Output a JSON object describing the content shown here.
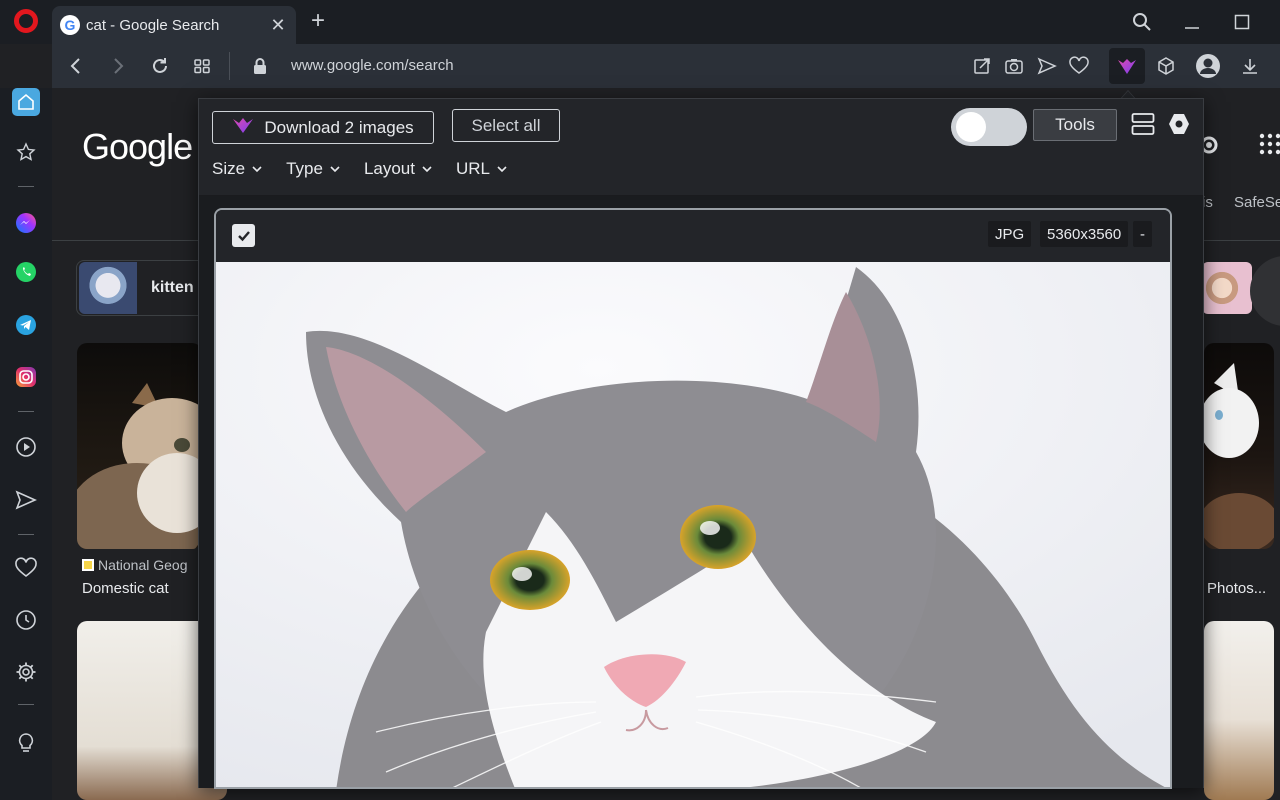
{
  "browser": {
    "tab": {
      "title": "cat - Google Search",
      "favicon": "G",
      "close_glyph": "✕"
    },
    "new_tab_glyph": "+",
    "url": "www.google.com/search"
  },
  "google": {
    "logo": "Google",
    "chip_label": "kitten",
    "results": [
      {
        "source": "National Geog",
        "caption": "Domestic cat"
      }
    ],
    "right_caption": "Photos...",
    "header_partial": {
      "as": "is",
      "safe": "SafeSe"
    }
  },
  "popup": {
    "download_label": "Download 2 images",
    "select_all_label": "Select all",
    "tools_label": "Tools",
    "toggle_on": false,
    "filters": [
      "Size",
      "Type",
      "Layout",
      "URL"
    ],
    "image": {
      "checked": true,
      "format": "JPG",
      "dimensions": "5360x3560",
      "extra": "-"
    }
  },
  "colors": {
    "opera_red": "#e3171e",
    "heart_gradient_start": "#c13ae0",
    "heart_gradient_end": "#7a3ef0",
    "cat_eye": "#d8a32a"
  },
  "icons": {
    "sidebar": [
      "home-icon",
      "star-icon",
      "messenger-icon",
      "whatsapp-icon",
      "telegram-icon",
      "instagram-icon",
      "player-icon",
      "send-icon",
      "heart-icon",
      "history-icon",
      "settings-icon",
      "bulb-icon"
    ]
  }
}
